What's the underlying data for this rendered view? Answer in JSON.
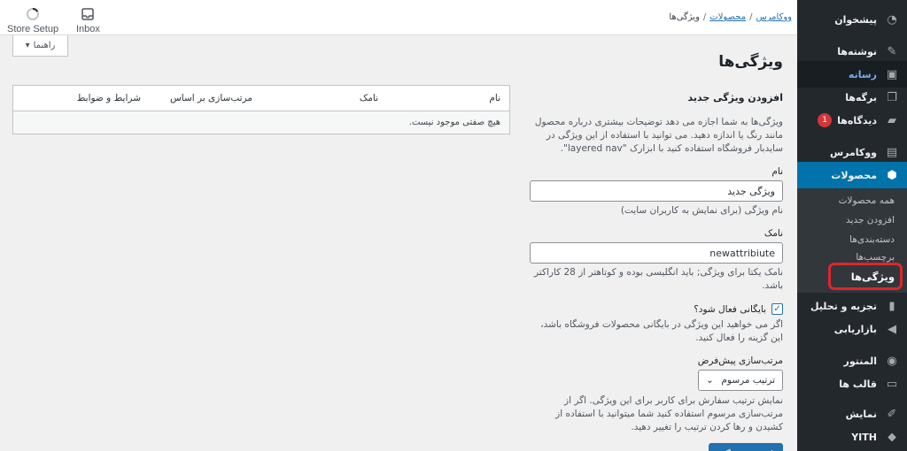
{
  "toolbar": {
    "store_setup": "Store Setup",
    "inbox": "Inbox",
    "help": "راهنما"
  },
  "breadcrumb": {
    "root": "ووکامرس",
    "parent": "محصولات",
    "current": "ویژگی‌ها",
    "sep": "/"
  },
  "page": {
    "title": "ویژگی‌ها"
  },
  "form": {
    "heading": "افزودن ویژگی جدید",
    "intro": "ویژگی‌ها به شما اجازه می دهد توضیحات بیشتری درباره محصول مانند رنگ یا اندازه دهید. می توانید با استفاده از این ویژگی در ساید‌بار فروشگاه استفاده کنید با ابزارک \"layered nav\".",
    "name_label": "نام",
    "name_value": "ویژگی جدید",
    "name_help": "نام ویژگی (برای نمایش به کاربران سایت)",
    "slug_label": "نامک",
    "slug_value": "newattribiute",
    "slug_help": "نامک یکتا برای ویژگی; باید انگلیسی بوده و کوتاهتر از 28 کاراکتر باشد.",
    "archive_label": "بایگانی فعال شود؟",
    "archive_checked": true,
    "archive_help": "اگر می خواهید این ویژگی در بایگانی محصولات فروشگاه باشد، این گزینه را فعال کنید.",
    "orderby_label": "مرتب‌سازی پیش‌فرض",
    "orderby_value": "ترتیب مرسوم",
    "orderby_help": "نمایش ترتیب سفارش برای کاربر برای این ویژگی. اگر از مرتب‌سازی مرسوم استفاده کنید شما میتوانید با استفاده از کشیدن و رها کردن ترتیب را تغییر دهید.",
    "submit": "افزودن ویژگی"
  },
  "table": {
    "columns": [
      "نام",
      "نامک",
      "مرتب‌سازی بر اساس",
      "شرایط و ضوابط"
    ],
    "empty": "هیچ صفتی موجود نیست."
  },
  "sidebar": {
    "items": [
      {
        "label": "پیشخوان",
        "icon": "dashboard-icon"
      },
      {
        "label": "نوشته‌ها",
        "icon": "pin-icon"
      },
      {
        "label": "رسانه",
        "icon": "media-icon"
      },
      {
        "label": "برگه‌ها",
        "icon": "pages-icon"
      },
      {
        "label": "دیدگاه‌ها",
        "icon": "comments-icon",
        "badge": "1"
      },
      {
        "label": "ووکامرس",
        "icon": "woocommerce-icon"
      },
      {
        "label": "محصولات",
        "icon": "products-icon"
      },
      {
        "label": "تجزیه و تحلیل",
        "icon": "analytics-icon"
      },
      {
        "label": "بازاریابی",
        "icon": "megaphone-icon"
      },
      {
        "label": "المنتور",
        "icon": "elementor-icon"
      },
      {
        "label": "قالب ها",
        "icon": "folder-icon"
      },
      {
        "label": "نمایش",
        "icon": "appearance-icon"
      },
      {
        "label": "YITH",
        "icon": "yith-icon"
      }
    ],
    "submenu": [
      {
        "label": "همه محصولات"
      },
      {
        "label": "افزودن جدید"
      },
      {
        "label": "دسته‌بندی‌ها"
      },
      {
        "label": "برچسب‌ها"
      },
      {
        "label": "ویژگی‌ها"
      }
    ]
  },
  "colors": {
    "accent": "#2271b1",
    "sidebar_bg": "#23282d",
    "active_menu": "#0073aa",
    "highlight_ring": "#e0252c"
  }
}
